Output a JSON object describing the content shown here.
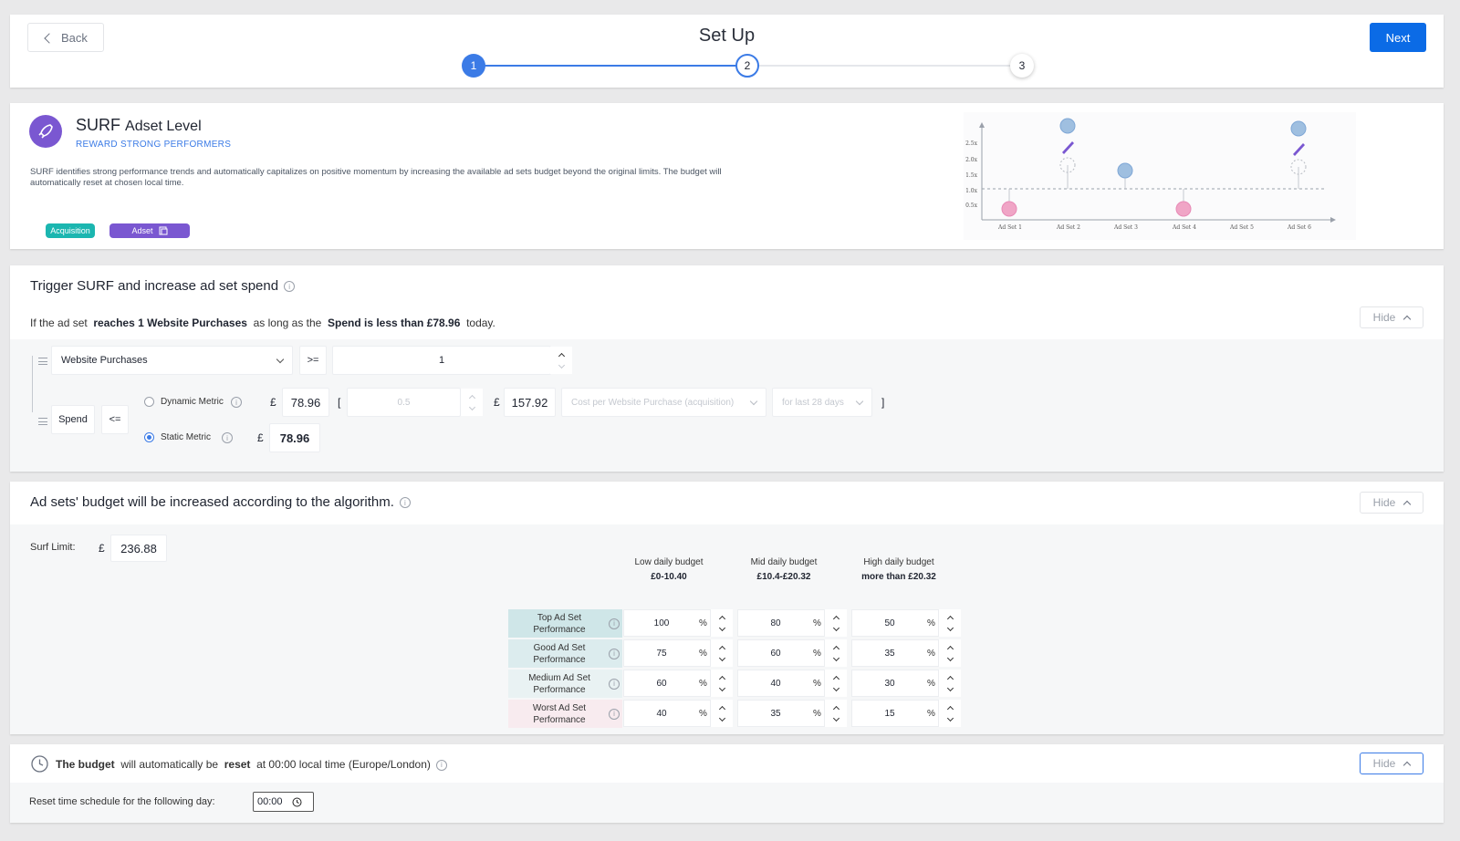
{
  "header": {
    "back_label": "Back",
    "title": "Set Up",
    "next_label": "Next",
    "steps": [
      "1",
      "2",
      "3"
    ]
  },
  "surf_info": {
    "name": "SURF",
    "name_suffix": "Adset Level",
    "subtitle": "REWARD STRONG PERFORMERS",
    "description": "SURF identifies strong performance trends and automatically capitalizes on positive momentum by increasing the available ad sets budget beyond the original limits. The budget will automatically reset at chosen local time.",
    "tags": [
      "Acquisition",
      "Adset"
    ],
    "chart": {
      "y_ticks": [
        "2.5x",
        "2.0x",
        "1.5x",
        "1.0x",
        "0.5x"
      ],
      "x_labels": [
        "Ad Set 1",
        "Ad Set 2",
        "Ad Set 3",
        "Ad Set 4",
        "Ad Set 5",
        "Ad Set 6"
      ]
    }
  },
  "trigger": {
    "title": "Trigger SURF and increase ad set spend",
    "sentence": {
      "p1": "If the ad set",
      "b1": "reaches 1 Website Purchases",
      "p2": "as long as the",
      "b2": "Spend is less than £78.96",
      "p3": "today."
    },
    "hide_label": "Hide",
    "metric_select": "Website Purchases",
    "operator1": ">=",
    "threshold": "1",
    "spend_label": "Spend",
    "operator2": "<=",
    "dynamic_label": "Dynamic Metric",
    "static_label": "Static Metric",
    "currency": "£",
    "dynamic_value": "78.96",
    "bracket_open": "[",
    "multiplier_placeholder": "0.5",
    "dynamic_computed": "157.92",
    "cost_metric": "Cost per Website Purchase (acquisition)",
    "period": "for last 28 days",
    "bracket_close": "]",
    "static_value": "78.96",
    "selected": "static"
  },
  "algorithm": {
    "title": "Ad sets' budget will be increased according to the algorithm.",
    "hide_label": "Hide",
    "surf_limit_label": "Surf Limit:",
    "currency": "£",
    "surf_limit": "236.88",
    "columns": [
      {
        "title": "Low daily budget",
        "range": "£0-10.40"
      },
      {
        "title": "Mid daily budget",
        "range": "£10.4-£20.32"
      },
      {
        "title": "High daily budget",
        "range": "more than £20.32"
      }
    ],
    "rows": [
      {
        "label": "Top Ad Set Performance",
        "color": "#cfe6e8",
        "values": [
          "100",
          "80",
          "50"
        ]
      },
      {
        "label": "Good Ad Set Performance",
        "color": "#dcecee",
        "values": [
          "75",
          "60",
          "35"
        ]
      },
      {
        "label": "Medium Ad Set Performance",
        "color": "#e9f2f3",
        "values": [
          "60",
          "40",
          "30"
        ]
      },
      {
        "label": "Worst Ad Set Performance",
        "color": "#f8ebef",
        "values": [
          "40",
          "35",
          "15"
        ]
      }
    ],
    "unit": "%"
  },
  "reset": {
    "p1": "The budget",
    "p2": "will automatically be",
    "p3": "reset",
    "p4": "at 00:00 local time (Europe/London)",
    "hide_label": "Hide",
    "schedule_label": "Reset time schedule for the following day:",
    "time": "00:00"
  },
  "colors": {
    "primary": "#0b6be6",
    "step_active": "#3b7be6",
    "surf_purple": "#7a57d1",
    "acquisition_teal": "#1bb6b0"
  }
}
